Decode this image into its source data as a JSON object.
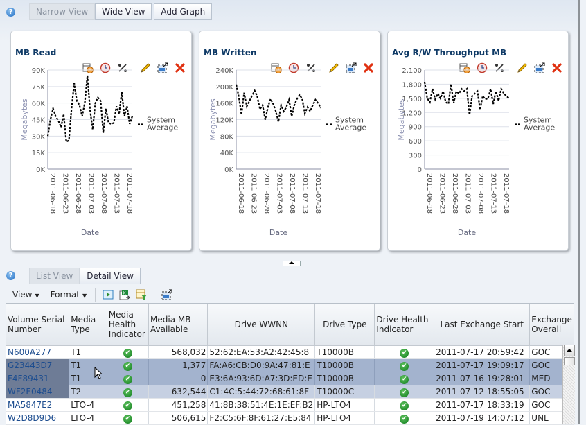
{
  "top_toolbar": {
    "help_icon": "?",
    "buttons": [
      {
        "label": "Narrow View",
        "state": "disabled"
      },
      {
        "label": "Wide View",
        "state": "enabled"
      },
      {
        "label": "Add Graph",
        "state": "enabled"
      }
    ]
  },
  "card_tools": [
    "calendar-clock-icon",
    "clock-icon",
    "percent-icon",
    "edit-pencil-icon",
    "export-table-icon",
    "close-icon"
  ],
  "chart_data": [
    {
      "type": "line",
      "title": "MB Read",
      "xlabel": "Date",
      "ylabel": "Megabytes",
      "ylim": [
        0,
        90000
      ],
      "yticks": [
        0,
        15000,
        30000,
        45000,
        60000,
        75000,
        90000
      ],
      "ytick_labels": [
        "0K",
        "15K",
        "30K",
        "45K",
        "60K",
        "75K",
        "90K"
      ],
      "xtick_labels": [
        "2011-06-18",
        "2011-06-23",
        "2011-06-28",
        "2011-07-03",
        "2011-07-08",
        "2011-07-13",
        "2011-07-18"
      ],
      "x_range_days": [
        0,
        33
      ],
      "grid": true,
      "legend": {
        "position": "right",
        "entries": [
          "System Average"
        ]
      },
      "series": [
        {
          "name": "System Average",
          "style": "dashed",
          "color": "#000000",
          "values": [
            30000,
            45000,
            55000,
            48000,
            44000,
            38000,
            50000,
            25000,
            26000,
            55000,
            78000,
            62000,
            58000,
            48000,
            60000,
            85000,
            54000,
            36000,
            60000,
            65000,
            62000,
            33000,
            55000,
            42000,
            41000,
            42000,
            57000,
            50000,
            70000,
            48000,
            57000,
            41000,
            48000
          ]
        }
      ]
    },
    {
      "type": "line",
      "title": "MB Written",
      "xlabel": "Date",
      "ylabel": "Megabytes",
      "ylim": [
        0,
        240000
      ],
      "yticks": [
        0,
        40000,
        80000,
        120000,
        160000,
        200000,
        240000
      ],
      "ytick_labels": [
        "0K",
        "40K",
        "80K",
        "120K",
        "160K",
        "200K",
        "240K"
      ],
      "xtick_labels": [
        "2011-06-18",
        "2011-06-23",
        "2011-06-28",
        "2011-07-03",
        "2011-07-08",
        "2011-07-13",
        "2011-07-18"
      ],
      "x_range_days": [
        0,
        33
      ],
      "grid": true,
      "legend": {
        "position": "right",
        "entries": [
          "System Average"
        ]
      },
      "series": [
        {
          "name": "System Average",
          "style": "dashed",
          "color": "#000000",
          "values": [
            205000,
            175000,
            132000,
            185000,
            152000,
            165000,
            178000,
            190000,
            175000,
            145000,
            155000,
            120000,
            150000,
            170000,
            158000,
            140000,
            115000,
            155000,
            140000,
            150000,
            168000,
            128000,
            155000,
            170000,
            180000,
            170000,
            135000,
            150000,
            140000,
            155000,
            168000,
            160000,
            148000
          ]
        }
      ]
    },
    {
      "type": "line",
      "title": "Avg R/W Throughput MB",
      "xlabel": "Date",
      "ylabel": "Megabytes",
      "ylim": [
        0,
        2100
      ],
      "yticks": [
        0,
        300,
        600,
        900,
        1200,
        1500,
        1800,
        2100
      ],
      "ytick_labels": [
        "0",
        "300",
        "600",
        "900",
        "1,200",
        "1,500",
        "1,800",
        "2,100"
      ],
      "xtick_labels": [
        "2011-06-18",
        "2011-06-23",
        "2011-06-28",
        "2011-07-03",
        "2011-07-08",
        "2011-07-13",
        "2011-07-18"
      ],
      "x_range_days": [
        0,
        33
      ],
      "grid": true,
      "legend": {
        "position": "right",
        "entries": [
          "System Average"
        ]
      },
      "series": [
        {
          "name": "System Average",
          "style": "dashed",
          "color": "#000000",
          "values": [
            1850,
            1500,
            1420,
            1700,
            1480,
            1600,
            1500,
            1650,
            1420,
            1380,
            1800,
            1400,
            1650,
            1600,
            1700,
            1650,
            1700,
            1150,
            1550,
            1600,
            1650,
            1260,
            1550,
            1480,
            1500,
            1700,
            1380,
            1650,
            1450,
            1700,
            1600,
            1550,
            1500
          ]
        }
      ]
    }
  ],
  "collapse_handle": "collapse-up",
  "bottom_tabs": {
    "help_icon": "?",
    "buttons": [
      {
        "label": "List View",
        "state": "disabled"
      },
      {
        "label": "Detail View",
        "state": "enabled"
      }
    ]
  },
  "table_toolbar": {
    "view_menu": "View",
    "format_menu": "Format",
    "icons": [
      "run-icon",
      "export-excel-icon",
      "filter-icon",
      "detach-icon"
    ]
  },
  "table": {
    "columns": [
      "Volume Serial Number",
      "Media Type",
      "Media Health Indicator",
      "Media MB Available",
      "Drive WWNN",
      "Drive Type",
      "Drive Health Indicator",
      "Last Exchange Start",
      "Exchange Overall"
    ],
    "rows": [
      {
        "vsn": "N600A277",
        "media_type": "T1",
        "media_health": "ok",
        "mb_available": "568,032",
        "wwnn": "52:62:EA:53:A2:42:45:8",
        "drive_type": "T10000B",
        "drive_health": "ok",
        "last_exchange": "2011-07-17 20:59:42",
        "exchange_overall": "GOC",
        "selected": "none"
      },
      {
        "vsn": "G23443D7",
        "media_type": "T1",
        "media_health": "ok",
        "mb_available": "1,377",
        "wwnn": "FA:A6:CB:D0:9A:47:81:E",
        "drive_type": "T10000B",
        "drive_health": "ok",
        "last_exchange": "2011-07-17 19:09:17",
        "exchange_overall": "GOC",
        "selected": "selected"
      },
      {
        "vsn": "F4F89431",
        "media_type": "T1",
        "media_health": "ok",
        "mb_available": "0",
        "wwnn": "E3:6A:93:6D:A7:3D:ED:E",
        "drive_type": "T10000B",
        "drive_health": "ok",
        "last_exchange": "2011-07-16 19:28:01",
        "exchange_overall": "MED",
        "selected": "selected"
      },
      {
        "vsn": "WF2E0484",
        "media_type": "T2",
        "media_health": "ok",
        "mb_available": "632,544",
        "wwnn": "C1:4C:5:44:72:68:61:8F",
        "drive_type": "T10000C",
        "drive_health": "ok",
        "last_exchange": "2011-07-12 18:55:05",
        "exchange_overall": "GOC",
        "selected": "hover"
      },
      {
        "vsn": "MA5847E2",
        "media_type": "LTO-4",
        "media_health": "ok",
        "mb_available": "451,258",
        "wwnn": "41:8B:38:51:4E:1E:EF:B2",
        "drive_type": "HP-LTO4",
        "drive_health": "ok",
        "last_exchange": "2011-07-17 18:33:19",
        "exchange_overall": "GOC",
        "selected": "none"
      },
      {
        "vsn": "W2D8D9D6",
        "media_type": "LTO-4",
        "media_health": "ok",
        "mb_available": "506,615",
        "wwnn": "F2:C5:6F:8F:61:27:E5:84",
        "drive_type": "HP-LTO4",
        "drive_health": "ok",
        "last_exchange": "2011-07-19 14:07:12",
        "exchange_overall": "UNL",
        "selected": "none"
      }
    ]
  },
  "colors": {
    "title_text": "#0f3a66",
    "link": "#1d4d8f",
    "selected_row": "#a3b3ce",
    "hover_row": "#c6d0e2",
    "health_ok": "#1a8a2a",
    "close_red": "#e03010"
  }
}
